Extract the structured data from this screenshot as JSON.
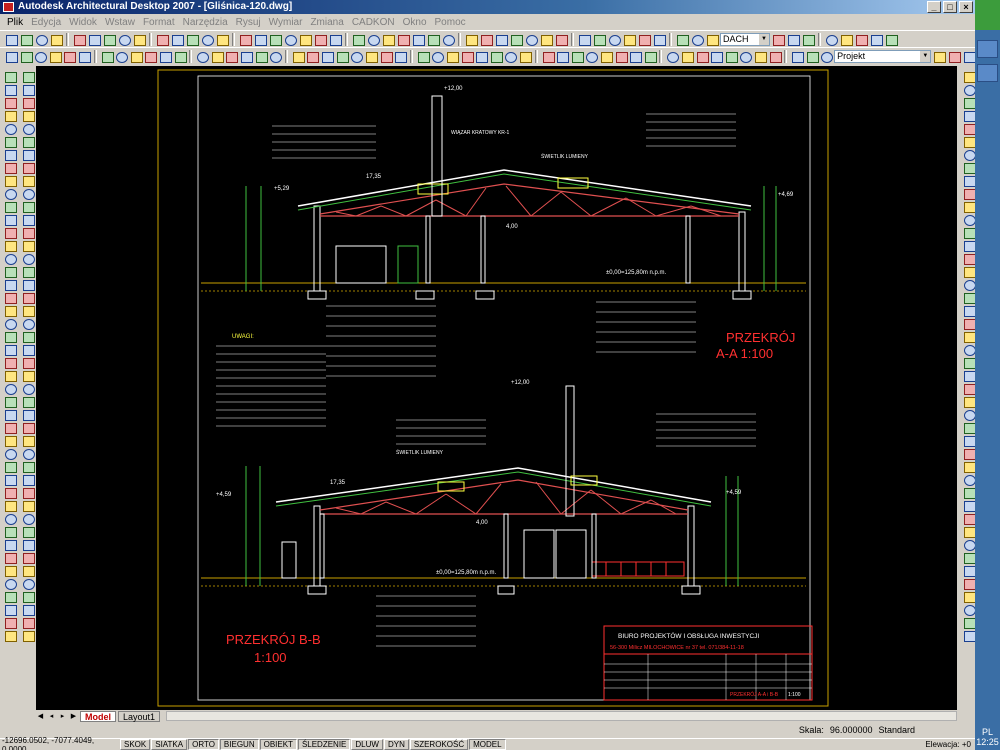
{
  "window": {
    "title": "Autodesk Architectural Desktop 2007 - [Gliśnica-120.dwg]"
  },
  "menu": [
    "Plik",
    "Edycja",
    "Widok",
    "Wstaw",
    "Format",
    "Narzędzia",
    "Rysuj",
    "Wymiar",
    "Zmiana",
    "CADKON",
    "Okno",
    "Pomoc"
  ],
  "toolbar": {
    "layer_combo": "DACH",
    "project_combo": "Projekt"
  },
  "drawing": {
    "section_aa_title_line1": "PRZEKRÓJ",
    "section_aa_title_line2": "A-A   1:100",
    "section_bb_title_line1": "PRZEKRÓJ B-B",
    "section_bb_title_line2": "1:100",
    "elev_top_a": "+12,00",
    "elev_top_b": "+12,00",
    "elev_a_left": "+5,29",
    "elev_a_right": "+4,69",
    "elev_b_left": "+4,59",
    "elev_b_right": "+4,59",
    "floor_a": "±0,00=125,80m n.p.m.",
    "floor_b": "±0,00=125,80m n.p.m.",
    "skylight_label_a": "ŚWIETLIK LUMIENY",
    "skylight_label_b": "ŚWIETLIK LUMIENY",
    "truss_label": "WIĄZAR KRATOWY KR-1",
    "notes_title": "UWAGI:",
    "slope_a": "17,35",
    "slope_b": "17,35",
    "mid_a": "4,00",
    "mid_b": "4,00",
    "title_block": {
      "office": "BIURO PROJEKTÓW I OBSŁUGA INWESTYCJI",
      "address": "56-300 Milicz  MILOCHOWICE nr 37    tel. 071/384-11-18",
      "sheet_name": "PRZEKRÓJ A-A i B-B",
      "scale": "1:100"
    }
  },
  "tabs": [
    {
      "label": "Model",
      "active": true
    },
    {
      "label": "Layout1",
      "active": false
    }
  ],
  "scale_bar": {
    "scale_label": "Skala:",
    "scale_value": "96.000000",
    "standard": "Standard"
  },
  "status": {
    "coords": "-12696.0502, -7077.4049, 0.0000",
    "buttons": [
      "SKOK",
      "SIATKA",
      "ORTO",
      "BIEGUN",
      "OBIEKT",
      "ŚLEDZENIE",
      "DLUW",
      "DYN",
      "SZEROKOŚĆ",
      "MODEL"
    ],
    "on_buttons": [
      "ORTO",
      "BIEGUN",
      "OBIEKT",
      "ŚLEDZENIE",
      "MODEL"
    ],
    "elevation": "Elewacja: +0"
  },
  "taskbar": {
    "lang": "PL",
    "clock": "12:25"
  },
  "colors": {
    "canvas": "#000000",
    "frame": "#c8a000",
    "truss": "#e05050",
    "label_red": "#ff3030",
    "line_white": "#ffffff",
    "line_green": "#40c040",
    "line_yellow": "#ffff40"
  }
}
